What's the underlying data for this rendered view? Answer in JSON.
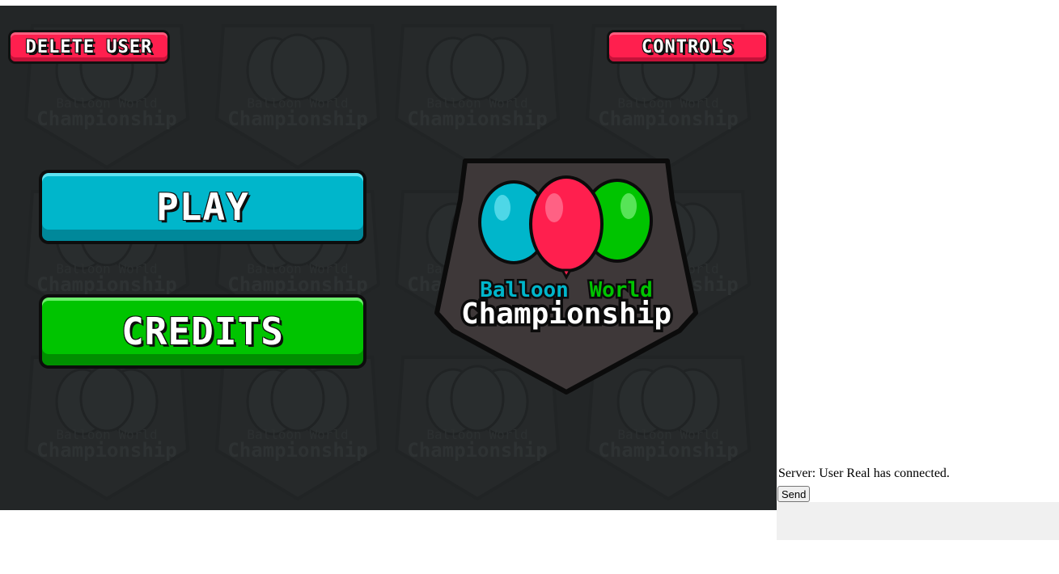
{
  "game": {
    "buttons": {
      "delete_user": "DELETE USER",
      "controls": "CONTROLS",
      "play": "PLAY",
      "credits": "CREDITS"
    },
    "logo": {
      "line1_parts": [
        "Balloon",
        "World"
      ],
      "line2": "Championship",
      "balloon_colors": [
        "#00b6cb",
        "#ff1f4e",
        "#00c400"
      ],
      "line1_colors": [
        "#00b6cb",
        "#ff1f4e",
        "#00c400"
      ]
    },
    "watermark": {
      "line1": "Balloon World",
      "line2": "Championship"
    },
    "colors": {
      "background": "#232627",
      "red_button": "#ff1f4e",
      "play_button": "#00b6cb",
      "credits_button": "#00c400"
    }
  },
  "chat": {
    "messages": [
      "Server: User Real has connected."
    ],
    "send_label": "Send",
    "input_value": ""
  }
}
